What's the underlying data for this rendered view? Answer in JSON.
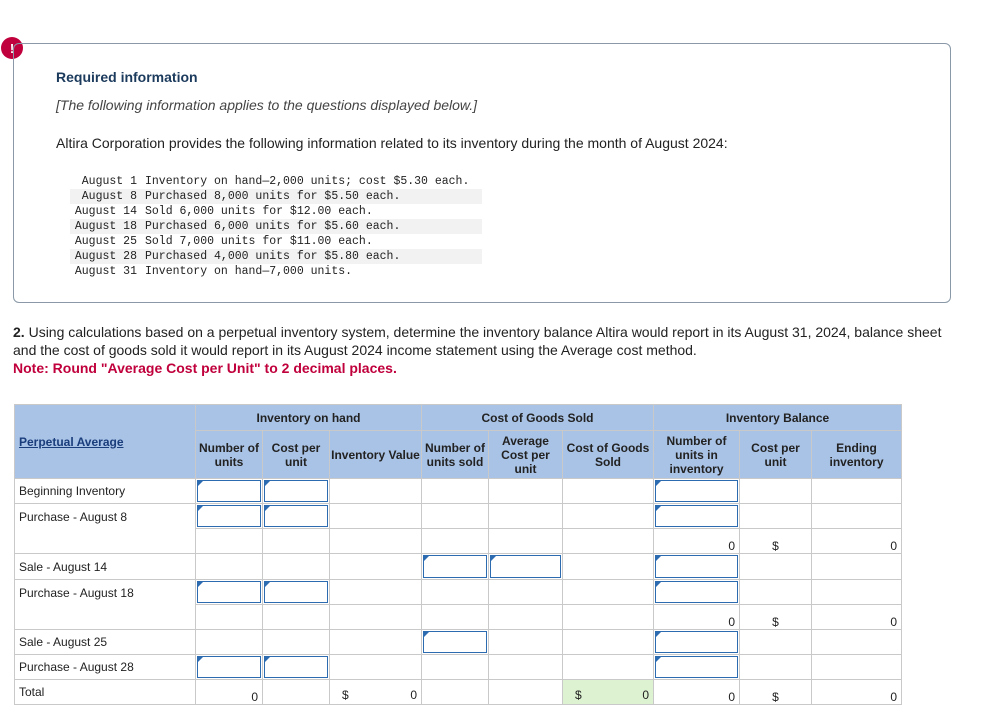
{
  "alert": {
    "symbol": "!"
  },
  "info": {
    "title": "Required information",
    "subtitle": "[The following information applies to the questions displayed below.]",
    "intro": "Altira Corporation provides the following information related to its inventory during the month of August 2024:",
    "rows": [
      {
        "date": "August 1",
        "desc": "Inventory on hand—2,000 units; cost $5.30 each."
      },
      {
        "date": "August 8",
        "desc": "Purchased 8,000 units for $5.50 each."
      },
      {
        "date": "August 14",
        "desc": "Sold 6,000 units for $12.00 each."
      },
      {
        "date": "August 18",
        "desc": "Purchased 6,000 units for $5.60 each."
      },
      {
        "date": "August 25",
        "desc": "Sold 7,000 units for $11.00 each."
      },
      {
        "date": "August 28",
        "desc": "Purchased 4,000 units for $5.80 each."
      },
      {
        "date": "August 31",
        "desc": "Inventory on hand—7,000 units."
      }
    ]
  },
  "question": {
    "number": "2.",
    "text": "Using calculations based on a perpetual inventory system, determine the inventory balance Altira would report in its August 31, 2024, balance sheet and the cost of goods sold it would report in its August 2024 income statement using the Average cost method.",
    "note": "Note: Round \"Average Cost per Unit\" to 2 decimal places."
  },
  "table": {
    "groups": {
      "on_hand": "Inventory on hand",
      "cogs": "Cost of Goods Sold",
      "balance": "Inventory Balance"
    },
    "perpetual_label": "Perpetual Average",
    "cols": {
      "oh_units": "Number of units",
      "oh_cost": "Cost per unit",
      "oh_value": "Inventory Value",
      "cg_units": "Number of units sold",
      "cg_avg": "Average Cost per unit",
      "cg_cogs": "Cost of Goods Sold",
      "bal_units": "Number of units in inventory",
      "bal_cost": "Cost per unit",
      "bal_end": "Ending inventory"
    },
    "rows": {
      "beginning": "Beginning Inventory",
      "purchase_aug8": "Purchase - August 8",
      "sale_aug14": "Sale - August 14",
      "purchase_aug18": "Purchase - August 18",
      "sale_aug25": "Sale - August 25",
      "purchase_aug28": "Purchase - August 28",
      "total": "Total"
    },
    "values": {
      "zero": "0",
      "dollar": "$"
    }
  }
}
